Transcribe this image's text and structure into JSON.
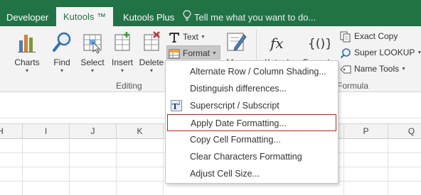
{
  "tabs": [
    {
      "label": "Developer",
      "active": false
    },
    {
      "label": "Kutools ™",
      "active": true
    },
    {
      "label": "Kutools Plus",
      "active": false
    }
  ],
  "tell_me": "Tell me what you want to do...",
  "ribbon": {
    "charts": "Charts",
    "find": "Find",
    "select": "Select",
    "insert": "Insert",
    "delete": "Delete",
    "text": "Text",
    "format": "Format",
    "more": "More",
    "kutools": "Kutools",
    "formula": "Formula",
    "editing_group": "Editing",
    "formula_group": "Formula",
    "exact_copy": "Exact Copy",
    "super_lookup": "Super LOOKUP",
    "name_tools": "Name Tools"
  },
  "columns": [
    "H",
    "I",
    "J",
    "K",
    "L",
    "M",
    "N",
    "O",
    "P",
    "Q"
  ],
  "menu": {
    "items": [
      {
        "label": "Alternate Row / Column Shading...",
        "icon": "none",
        "highlighted": false
      },
      {
        "label": "Distinguish differences...",
        "icon": "none",
        "highlighted": false
      },
      {
        "label": "Superscript / Subscript",
        "icon": "superscript-icon",
        "highlighted": false
      },
      {
        "label": "Apply Date Formatting...",
        "icon": "none",
        "highlighted": true
      },
      {
        "label": "Copy Cell Formatting...",
        "icon": "none",
        "highlighted": false
      },
      {
        "label": "Clear Characters Formatting",
        "icon": "none",
        "highlighted": false
      },
      {
        "label": "Adjust Cell Size...",
        "icon": "none",
        "highlighted": false
      }
    ]
  },
  "colors": {
    "tab_bar": "#217346",
    "ribbon": "#f3f3f3",
    "highlight_border": "#a52a2a"
  }
}
